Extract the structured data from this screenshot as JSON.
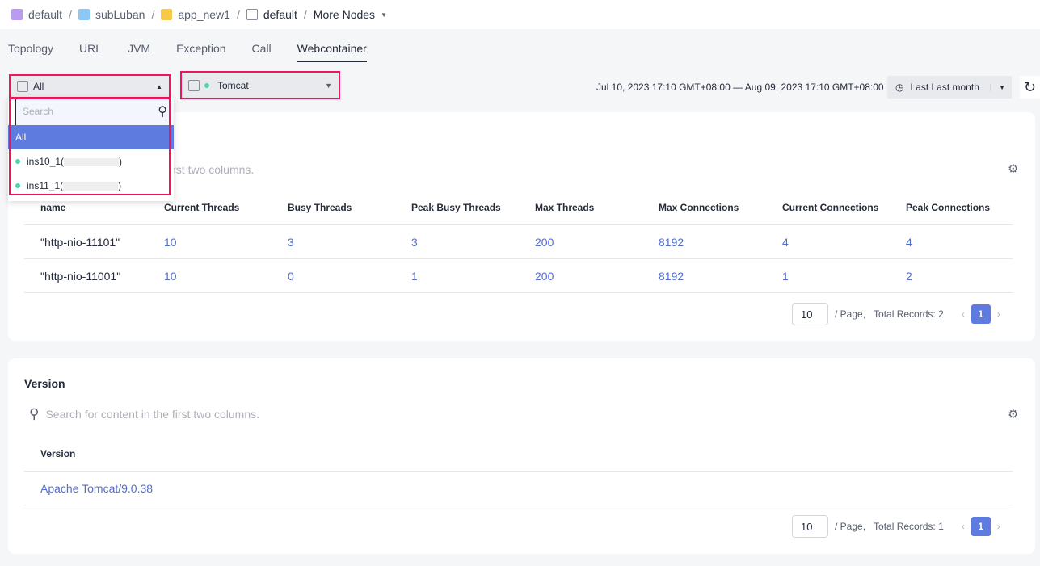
{
  "breadcrumb": [
    {
      "label": "default",
      "icon": "project-icon"
    },
    {
      "label": "subLuban",
      "icon": "folder-icon"
    },
    {
      "label": "app_new1",
      "icon": "app-cube-icon"
    },
    {
      "label": "default",
      "icon": "environment-icon"
    },
    {
      "label": "More Nodes",
      "icon": "caret-down-icon"
    }
  ],
  "tabs": [
    "Topology",
    "URL",
    "JVM",
    "Exception",
    "Call",
    "Webcontainer"
  ],
  "active_tab": "Webcontainer",
  "instance_select": {
    "value": "All",
    "search_placeholder": "Search",
    "options": [
      {
        "label": "All",
        "selected": true
      },
      {
        "label": "ins10_1(",
        "suffix": ")",
        "status": "running"
      },
      {
        "label": "ins11_1(",
        "suffix": ")",
        "status": "running"
      }
    ]
  },
  "container_select": {
    "value": "Tomcat"
  },
  "time_range": {
    "text": "Jul 10, 2023 17:10 GMT+08:00 — Aug 09, 2023 17:10 GMT+08:00",
    "preset": "Last Last month"
  },
  "threads_card": {
    "search_placeholder": "Search for content in the first two columns.",
    "columns": [
      "name",
      "Current Threads",
      "Busy Threads",
      "Peak Busy Threads",
      "Max Threads",
      "Max Connections",
      "Current Connections",
      "Peak Connections"
    ],
    "rows": [
      [
        "\"http-nio-11101\"",
        "10",
        "3",
        "3",
        "200",
        "8192",
        "4",
        "4"
      ],
      [
        "\"http-nio-11001\"",
        "10",
        "0",
        "1",
        "200",
        "8192",
        "1",
        "2"
      ]
    ],
    "page_size": "10",
    "per_page": "/ Page,",
    "total": "Total Records: 2",
    "page": "1"
  },
  "version_card": {
    "title": "Version",
    "search_placeholder": "Search for content in the first two columns.",
    "columns": [
      "Version"
    ],
    "rows": [
      [
        "Apache Tomcat/9.0.38"
      ]
    ],
    "page_size": "10",
    "per_page": "/ Page,",
    "total": "Total Records: 1",
    "page": "1"
  },
  "colors": {
    "accent": "#5e7ce0",
    "highlight": "#f0145a",
    "status": "#50d4ab"
  }
}
